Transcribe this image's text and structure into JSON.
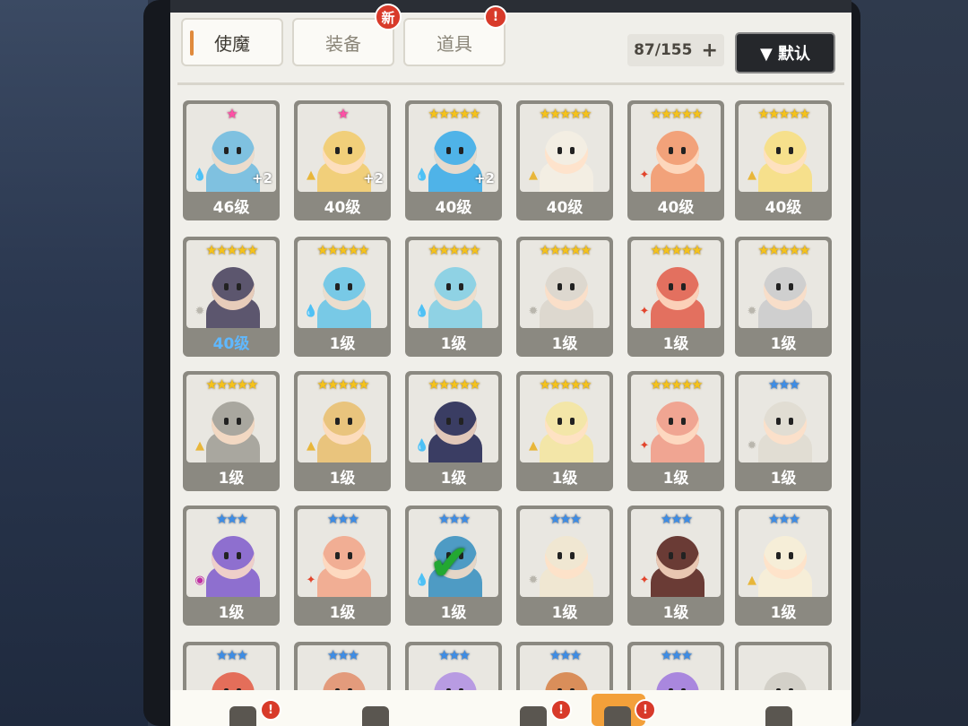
{
  "tabs": [
    {
      "label": "使魔",
      "active": true,
      "badge": ""
    },
    {
      "label": "装备",
      "active": false,
      "badge": "新"
    },
    {
      "label": "道具",
      "active": false,
      "badge": "!"
    }
  ],
  "inventory_count": "87/155",
  "add_symbol": "+",
  "sort_label": "▼ 默认",
  "colors": {
    "accent": "#e08a3c",
    "badge": "#d83a2a",
    "gold_star": "#f5c21a",
    "blue_star": "#3d8de6"
  },
  "cards": [
    {
      "stars": "★",
      "star_color": "pink",
      "level": "46级",
      "element": "water",
      "plus": "+2",
      "hue": "#7fc1e0"
    },
    {
      "stars": "★",
      "star_color": "pink",
      "level": "40级",
      "element": "earth",
      "plus": "+2",
      "hue": "#f1cf7a"
    },
    {
      "stars": "★★★★★",
      "star_color": "gold",
      "level": "40级",
      "element": "water",
      "plus": "+2",
      "hue": "#4fb3e8"
    },
    {
      "stars": "★★★★★",
      "star_color": "gold",
      "level": "40级",
      "element": "earth",
      "plus": "",
      "hue": "#f3eee3"
    },
    {
      "stars": "★★★★★",
      "star_color": "gold",
      "level": "40级",
      "element": "fire",
      "plus": "",
      "hue": "#f2a27a"
    },
    {
      "stars": "★★★★★",
      "star_color": "gold",
      "level": "40级",
      "element": "earth",
      "plus": "",
      "hue": "#f6e08c"
    },
    {
      "stars": "★★★★★",
      "star_color": "gold",
      "level": "40级",
      "level_blue": true,
      "element": "light",
      "plus": "",
      "hue": "#5c566e"
    },
    {
      "stars": "★★★★★",
      "star_color": "gold",
      "level": "1级",
      "element": "water",
      "plus": "",
      "hue": "#78c9e6"
    },
    {
      "stars": "★★★★★",
      "star_color": "gold",
      "level": "1级",
      "element": "water",
      "plus": "",
      "hue": "#8fd2e4"
    },
    {
      "stars": "★★★★★",
      "star_color": "gold",
      "level": "1级",
      "element": "light",
      "plus": "",
      "hue": "#ddd8cf"
    },
    {
      "stars": "★★★★★",
      "star_color": "gold",
      "level": "1级",
      "element": "fire",
      "plus": "",
      "hue": "#e3705f"
    },
    {
      "stars": "★★★★★",
      "star_color": "gold",
      "level": "1级",
      "element": "light",
      "plus": "",
      "hue": "#cfcfcf"
    },
    {
      "stars": "★★★★★",
      "star_color": "gold",
      "level": "1级",
      "element": "earth",
      "plus": "",
      "hue": "#a9a79f"
    },
    {
      "stars": "★★★★★",
      "star_color": "gold",
      "level": "1级",
      "element": "earth",
      "plus": "",
      "hue": "#e9c47d"
    },
    {
      "stars": "★★★★★",
      "star_color": "gold",
      "level": "1级",
      "element": "water",
      "plus": "",
      "hue": "#3a3d63"
    },
    {
      "stars": "★★★★★",
      "star_color": "gold",
      "level": "1级",
      "element": "earth",
      "plus": "",
      "hue": "#f3e6a8"
    },
    {
      "stars": "★★★★★",
      "star_color": "gold",
      "level": "1级",
      "element": "fire",
      "plus": "",
      "hue": "#f0a592"
    },
    {
      "stars": "★★★",
      "star_color": "blue",
      "level": "1级",
      "element": "light",
      "plus": "",
      "hue": "#e1ddd3"
    },
    {
      "stars": "★★★",
      "star_color": "blue",
      "level": "1级",
      "element": "dark",
      "plus": "",
      "hue": "#8e6fcf"
    },
    {
      "stars": "★★★",
      "star_color": "blue",
      "level": "1级",
      "element": "fire",
      "plus": "",
      "hue": "#f1ae94"
    },
    {
      "stars": "★★★",
      "star_color": "blue",
      "level": "1级",
      "element": "water",
      "plus": "",
      "hue": "#4e9bc4",
      "checked": true
    },
    {
      "stars": "★★★",
      "star_color": "blue",
      "level": "1级",
      "element": "light",
      "plus": "",
      "hue": "#f0e7d2"
    },
    {
      "stars": "★★★",
      "star_color": "blue",
      "level": "1级",
      "element": "fire",
      "plus": "",
      "hue": "#6a3b35"
    },
    {
      "stars": "★★★",
      "star_color": "blue",
      "level": "1级",
      "element": "earth",
      "plus": "",
      "hue": "#f6eed8"
    },
    {
      "stars": "★★★",
      "star_color": "blue",
      "level": "",
      "element": "",
      "plus": "",
      "hue": "#e46e5a"
    },
    {
      "stars": "★★★",
      "star_color": "blue",
      "level": "",
      "element": "",
      "plus": "",
      "hue": "#e39b7c"
    },
    {
      "stars": "★★★",
      "star_color": "blue",
      "level": "",
      "element": "",
      "plus": "",
      "hue": "#b89be2"
    },
    {
      "stars": "★★★",
      "star_color": "blue",
      "level": "",
      "element": "",
      "plus": "",
      "hue": "#d98e5a"
    },
    {
      "stars": "★★★",
      "star_color": "blue",
      "level": "",
      "element": "",
      "plus": "",
      "hue": "#a987de"
    },
    {
      "stars": "",
      "star_color": "blue",
      "level": "",
      "element": "",
      "plus": "",
      "hue": "#d3d0c8"
    }
  ],
  "bottom_nav": [
    {
      "icon": "castle-icon",
      "badge": "!"
    },
    {
      "icon": "sword-icon",
      "badge": ""
    },
    {
      "icon": "flag-icon",
      "badge": "!"
    },
    {
      "icon": "treasure-icon",
      "badge": "!",
      "active": true
    },
    {
      "icon": "shield-icon",
      "badge": ""
    }
  ]
}
